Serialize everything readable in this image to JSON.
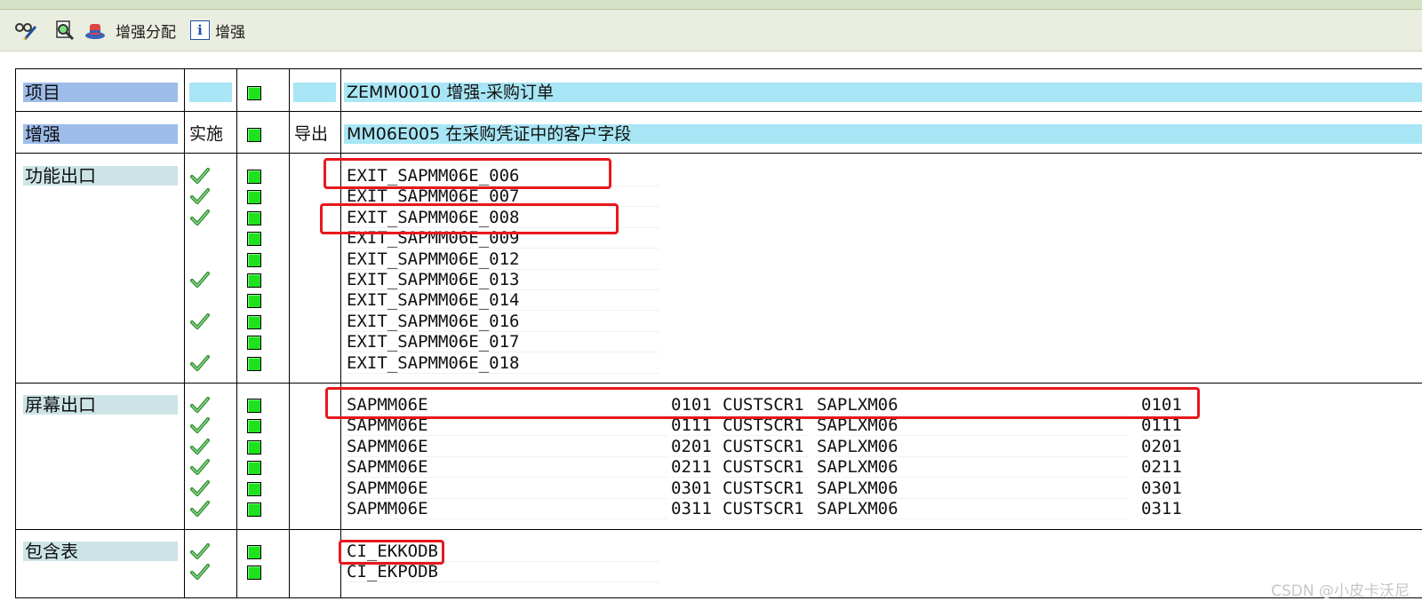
{
  "toolbar": {
    "assign_label": "增强分配",
    "info_label": "增强"
  },
  "header": {
    "project_label": "项目",
    "project_value": "ZEMM0010 增强-采购订单",
    "enh_label": "增强",
    "impl_label": "实施",
    "export_label": "导出",
    "enh_value": "MM06E005 在采购凭证中的客户字段"
  },
  "function_exits": {
    "label": "功能出口",
    "rows": [
      {
        "name": "EXIT_SAPMM06E_006",
        "checked": true
      },
      {
        "name": "EXIT_SAPMM06E_007",
        "checked": true
      },
      {
        "name": "EXIT_SAPMM06E_008",
        "checked": true
      },
      {
        "name": "EXIT_SAPMM06E_009",
        "checked": false
      },
      {
        "name": "EXIT_SAPMM06E_012",
        "checked": false
      },
      {
        "name": "EXIT_SAPMM06E_013",
        "checked": true
      },
      {
        "name": "EXIT_SAPMM06E_014",
        "checked": false
      },
      {
        "name": "EXIT_SAPMM06E_016",
        "checked": true
      },
      {
        "name": "EXIT_SAPMM06E_017",
        "checked": false
      },
      {
        "name": "EXIT_SAPMM06E_018",
        "checked": true
      }
    ]
  },
  "screen_exits": {
    "label": "屏幕出口",
    "rows": [
      {
        "program": "SAPMM06E",
        "screen": "0101",
        "area": "CUSTSCR1",
        "called_program": "SAPLXM06",
        "called_screen": "0101",
        "checked": true
      },
      {
        "program": "SAPMM06E",
        "screen": "0111",
        "area": "CUSTSCR1",
        "called_program": "SAPLXM06",
        "called_screen": "0111",
        "checked": true
      },
      {
        "program": "SAPMM06E",
        "screen": "0201",
        "area": "CUSTSCR1",
        "called_program": "SAPLXM06",
        "called_screen": "0201",
        "checked": true
      },
      {
        "program": "SAPMM06E",
        "screen": "0211",
        "area": "CUSTSCR1",
        "called_program": "SAPLXM06",
        "called_screen": "0211",
        "checked": true
      },
      {
        "program": "SAPMM06E",
        "screen": "0301",
        "area": "CUSTSCR1",
        "called_program": "SAPLXM06",
        "called_screen": "0301",
        "checked": true
      },
      {
        "program": "SAPMM06E",
        "screen": "0311",
        "area": "CUSTSCR1",
        "called_program": "SAPLXM06",
        "called_screen": "0311",
        "checked": true
      }
    ]
  },
  "includes": {
    "label": "包含表",
    "rows": [
      {
        "name": "CI_EKKODB",
        "checked": true
      },
      {
        "name": "CI_EKPODB",
        "checked": true
      }
    ]
  },
  "watermark": "CSDN @小皮卡沃尼",
  "colors": {
    "header_blue": "#9dbcea",
    "bar_cyan": "#a8e6f5",
    "status_green": "#1ee21e",
    "highlight_red": "#e8171b"
  }
}
